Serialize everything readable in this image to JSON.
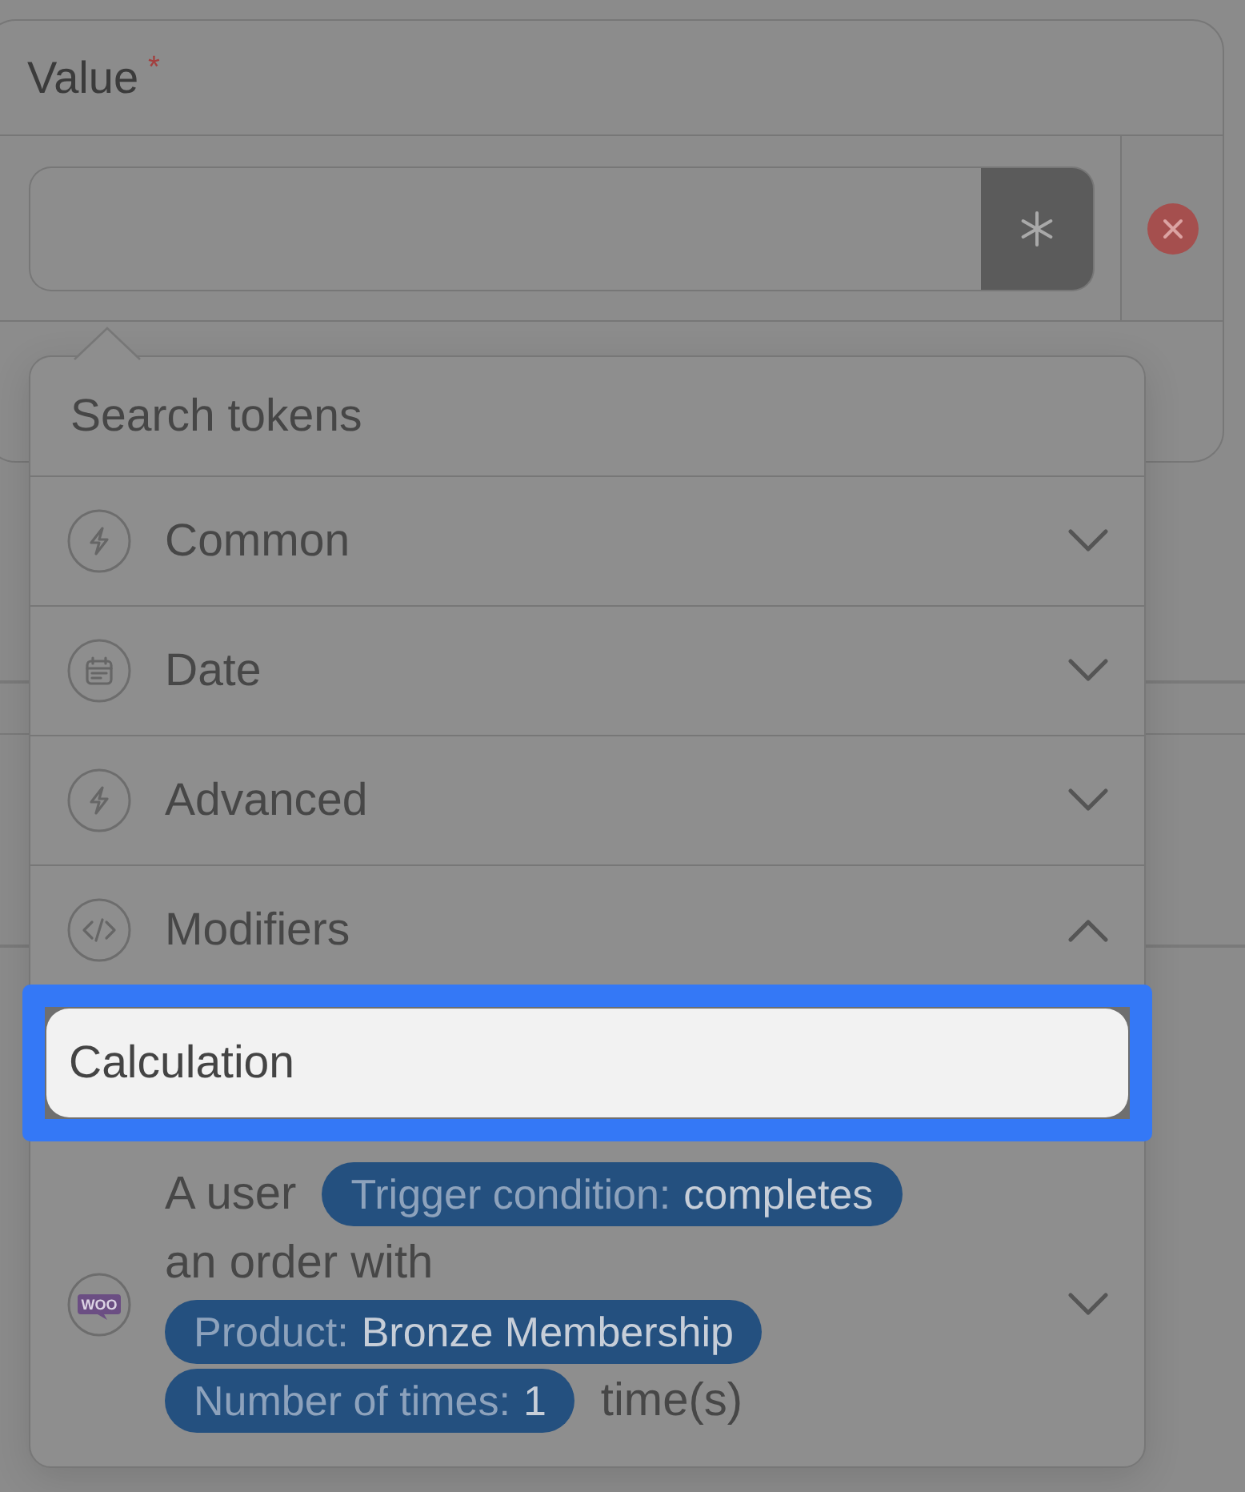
{
  "value_field": {
    "label": "Value",
    "required_mark": "*"
  },
  "token_picker": {
    "search": {
      "placeholder": "Search tokens"
    },
    "sections": [
      {
        "label": "Common",
        "expanded": false
      },
      {
        "label": "Date",
        "expanded": false
      },
      {
        "label": "Advanced",
        "expanded": false
      },
      {
        "label": "Modifiers",
        "expanded": true,
        "children": [
          {
            "label": "Calculation",
            "highlighted": true
          }
        ]
      }
    ],
    "trigger": {
      "logo_text": "WOO",
      "expanded": false,
      "sentence": [
        {
          "kind": "text",
          "text": "A user"
        },
        {
          "kind": "token",
          "label": "Trigger condition:",
          "value": "completes"
        },
        {
          "kind": "text",
          "text": "an order with"
        },
        {
          "kind": "token",
          "label": "Product:",
          "value": "Bronze Membership"
        },
        {
          "kind": "token",
          "label": "Number of times:",
          "value": "1"
        },
        {
          "kind": "text",
          "text": "time(s)"
        }
      ]
    }
  }
}
